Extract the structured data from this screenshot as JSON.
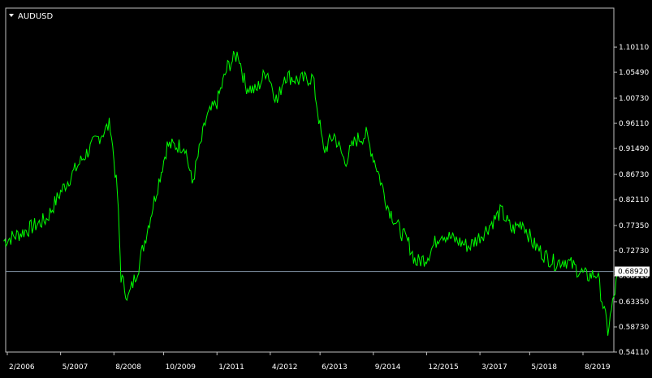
{
  "window": {
    "symbol": "AUDUSD"
  },
  "colors": {
    "background": "#000000",
    "frame": "#c0c0c0",
    "series": "#00ff00",
    "price_line": "#8a9cb0",
    "text": "#ffffff",
    "price_box": "#ffffff"
  },
  "icons": {
    "symbol_menu": "triangle-down-icon"
  },
  "current_price_label": "0.68920",
  "chart_data": {
    "type": "line",
    "title": "AUDUSD",
    "xlabel": "",
    "ylabel": "",
    "grid": false,
    "ylim": [
      0.5411,
      1.1325
    ],
    "y_ticks": [
      "1.10110",
      "1.05490",
      "1.00730",
      "0.96110",
      "0.91490",
      "0.86730",
      "0.82110",
      "0.77350",
      "0.72730",
      "0.68110",
      "0.63350",
      "0.58730",
      "0.54110"
    ],
    "x_ticks": [
      "2/2006",
      "5/2007",
      "8/2008",
      "10/2009",
      "1/2011",
      "4/2012",
      "6/2013",
      "9/2014",
      "12/2015",
      "3/2017",
      "5/2018",
      "8/2019"
    ],
    "current_price": 0.6892,
    "series": [
      {
        "x": [
          "2006-01",
          "2006-06",
          "2007-01",
          "2007-05",
          "2007-11",
          "2008-03",
          "2008-07",
          "2008-09",
          "2008-10",
          "2008-12",
          "2009-03",
          "2009-07",
          "2009-11",
          "2010-04",
          "2010-06",
          "2010-10",
          "2011-01",
          "2011-04",
          "2011-07",
          "2011-09",
          "2011-12",
          "2012-03",
          "2012-06",
          "2012-08",
          "2012-12",
          "2013-04",
          "2013-07",
          "2013-10",
          "2014-01",
          "2014-04",
          "2014-07",
          "2014-10",
          "2015-01",
          "2015-04",
          "2015-07",
          "2015-09",
          "2015-12",
          "2016-04",
          "2016-07",
          "2016-12",
          "2017-04",
          "2017-09",
          "2017-12",
          "2018-03",
          "2018-06",
          "2018-09",
          "2018-12",
          "2019-03",
          "2019-06",
          "2019-09",
          "2019-12",
          "2020-03",
          "2020-06"
        ],
        "y": [
          0.745,
          0.76,
          0.785,
          0.835,
          0.895,
          0.93,
          0.96,
          0.83,
          0.68,
          0.64,
          0.7,
          0.81,
          0.92,
          0.92,
          0.85,
          0.97,
          1.0,
          1.065,
          1.09,
          1.03,
          1.02,
          1.06,
          1.0,
          1.05,
          1.04,
          1.045,
          0.91,
          0.94,
          0.89,
          0.93,
          0.94,
          0.88,
          0.81,
          0.77,
          0.74,
          0.705,
          0.715,
          0.76,
          0.75,
          0.735,
          0.76,
          0.8,
          0.765,
          0.78,
          0.74,
          0.72,
          0.705,
          0.71,
          0.695,
          0.68,
          0.685,
          0.58,
          0.69
        ]
      }
    ]
  }
}
